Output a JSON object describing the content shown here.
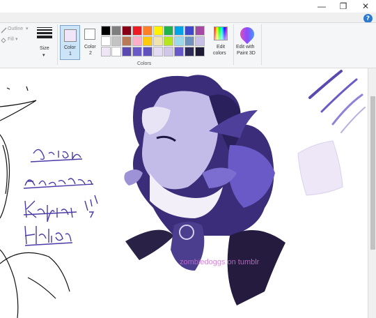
{
  "window": {
    "minimize_glyph": "—",
    "maximize_glyph": "❐",
    "close_glyph": "✕",
    "help_glyph": "?"
  },
  "ribbon": {
    "outline_label": "Outline",
    "fill_label": "Fill",
    "size_label": "Size",
    "color1_label_line1": "Color",
    "color1_label_line2": "1",
    "color2_label_line1": "Color",
    "color2_label_line2": "2",
    "color1_value": "#f0e6f7",
    "color2_value": "#ffffff",
    "edit_colors_line1": "Edit",
    "edit_colors_line2": "colors",
    "paint3d_line1": "Edit with",
    "paint3d_line2": "Paint 3D",
    "colors_group_label": "Colors",
    "palette": [
      "#000000",
      "#7f7f7f",
      "#880015",
      "#ed1c24",
      "#ff7f27",
      "#fff200",
      "#22b14c",
      "#00a2e8",
      "#3f48cc",
      "#a349a4",
      "#ffffff",
      "#c3c3c3",
      "#b97a57",
      "#ffaec9",
      "#ffc90e",
      "#efe4b0",
      "#b5e61d",
      "#99d9ea",
      "#7092be",
      "#c8bfe7",
      "#eee5f5",
      "#ffffff",
      "#5a4ab0",
      "#6a5ac8",
      "#5f52bf",
      "#e4dcf2",
      "#cfc6ea",
      "#6658c8",
      "#2e2a5a",
      "#1e1a33"
    ]
  },
  "canvas": {
    "handwritten_names": [
      "Orion",
      "Andromeda",
      "Kepler",
      "Helios"
    ],
    "watermark": "zombiedoggs on tumblr"
  }
}
